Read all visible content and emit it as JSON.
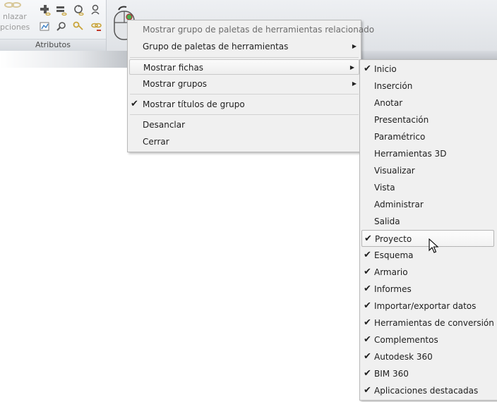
{
  "ribbon": {
    "panel_title": "Atributos",
    "big_button_label_line1": "nlazar",
    "big_button_label_line2": "pciones"
  },
  "context_menu": {
    "items": [
      {
        "label": "Mostrar grupo de paletas de herramientas relacionado",
        "disabled": true
      },
      {
        "label": "Grupo de paletas de herramientas",
        "submenu": true
      },
      {
        "label": "Mostrar fichas",
        "submenu": true,
        "highlighted": true
      },
      {
        "label": "Mostrar grupos",
        "submenu": true
      },
      {
        "label": "Mostrar títulos de grupo",
        "checked": true
      },
      {
        "label": "Desanclar"
      },
      {
        "label": "Cerrar"
      }
    ]
  },
  "submenu": {
    "items": [
      {
        "label": "Inicio",
        "checked": true
      },
      {
        "label": "Inserción",
        "checked": false
      },
      {
        "label": "Anotar",
        "checked": false
      },
      {
        "label": "Presentación",
        "checked": false
      },
      {
        "label": "Paramétrico",
        "checked": false
      },
      {
        "label": "Herramientas 3D",
        "checked": false
      },
      {
        "label": "Visualizar",
        "checked": false
      },
      {
        "label": "Vista",
        "checked": false
      },
      {
        "label": "Administrar",
        "checked": false
      },
      {
        "label": "Salida",
        "checked": false
      },
      {
        "label": "Proyecto",
        "checked": true,
        "hovered": true
      },
      {
        "label": "Esquema",
        "checked": true
      },
      {
        "label": "Armario",
        "checked": true
      },
      {
        "label": "Informes",
        "checked": true
      },
      {
        "label": "Importar/exportar datos",
        "checked": true
      },
      {
        "label": "Herramientas de conversión",
        "checked": true
      },
      {
        "label": "Complementos",
        "checked": true
      },
      {
        "label": "Autodesk 360",
        "checked": true
      },
      {
        "label": "BIM 360",
        "checked": true
      },
      {
        "label": "Aplicaciones destacadas",
        "checked": true
      }
    ]
  },
  "glyphs": {
    "check": "✔",
    "arrow": "▶"
  },
  "icons": [
    "link-attribute-icon",
    "add-icon",
    "list-icon",
    "refresh-link-icon",
    "user-icon",
    "chart-icon",
    "search-icon",
    "key-link-icon",
    "remove-link-icon",
    "mouse-icon",
    "cursor-icon"
  ]
}
